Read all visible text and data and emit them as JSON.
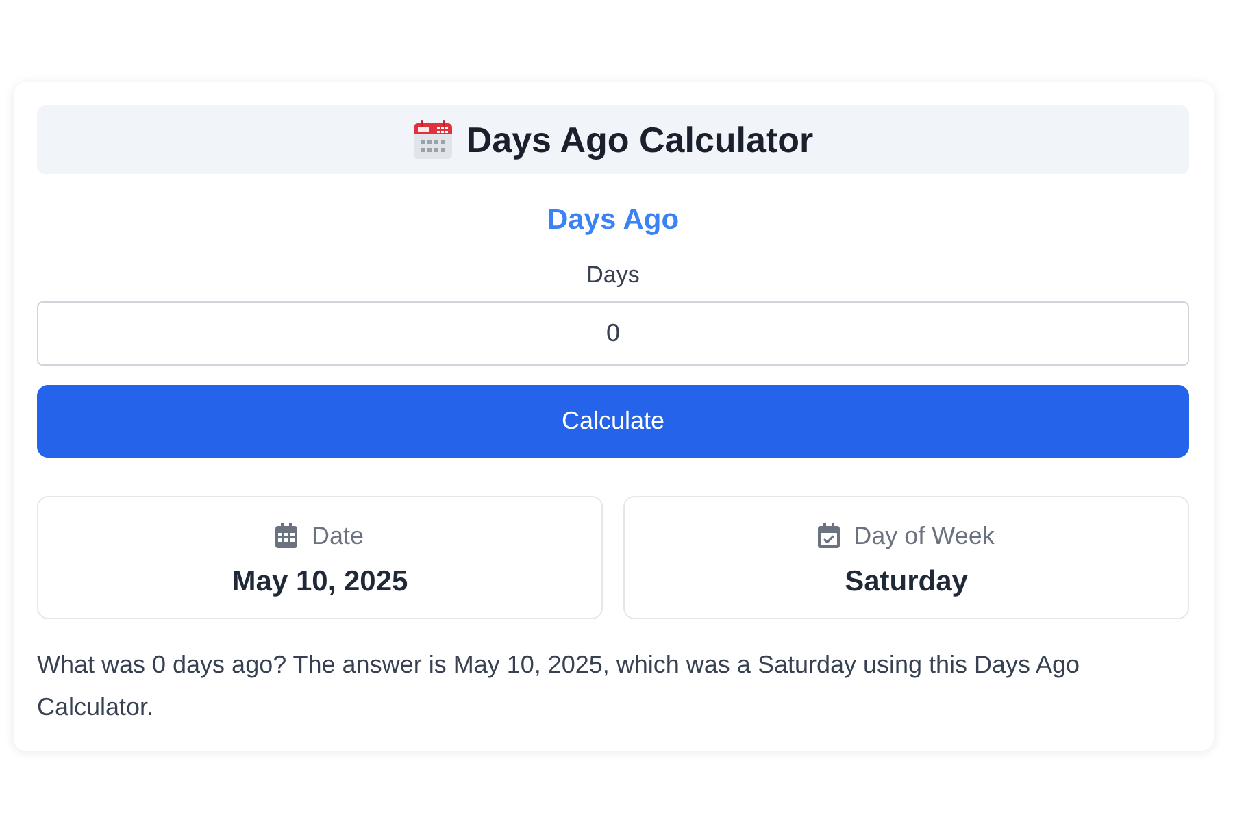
{
  "header": {
    "title": "Days Ago Calculator"
  },
  "section_title": "Days Ago",
  "days_field": {
    "label": "Days",
    "value": "0"
  },
  "calculate_button": {
    "label": "Calculate"
  },
  "results": [
    {
      "kind": "date",
      "label": "Date",
      "value": "May 10, 2025"
    },
    {
      "kind": "weekday",
      "label": "Day of Week",
      "value": "Saturday"
    }
  ],
  "summary": "What was 0 days ago? The answer is May 10, 2025, which was a Saturday using this Days Ago Calculator."
}
